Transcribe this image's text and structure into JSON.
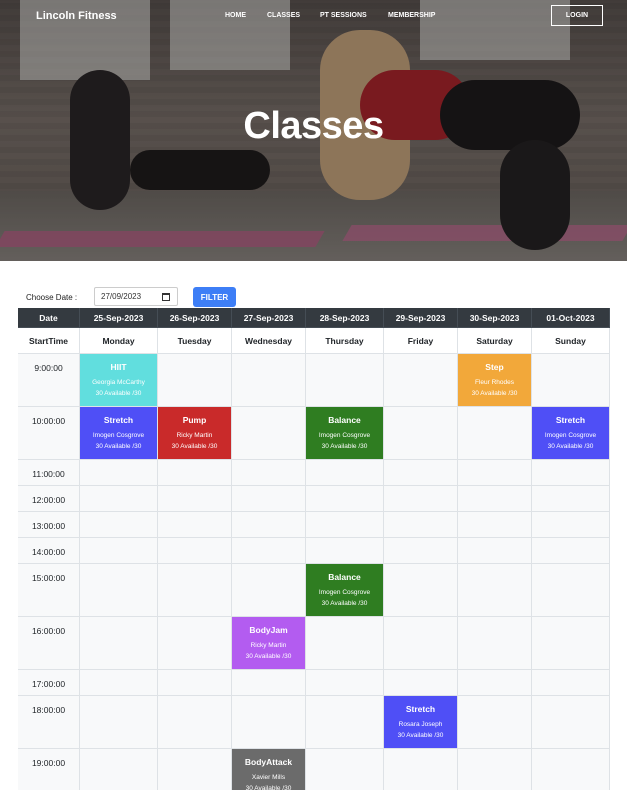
{
  "header": {
    "brand": "Lincoln Fitness",
    "nav": [
      "HOME",
      "CLASSES",
      "PT SESSIONS",
      "MEMBERSHIP"
    ],
    "login": "LOGIN",
    "title": "Classes"
  },
  "filter": {
    "label": "Choose Date :",
    "value": "27/09/2023",
    "button": "FILTER"
  },
  "timetable": {
    "col_date": "Date",
    "col_time": "StartTime",
    "dates": [
      "25-Sep-2023",
      "26-Sep-2023",
      "27-Sep-2023",
      "28-Sep-2023",
      "29-Sep-2023",
      "30-Sep-2023",
      "01-Oct-2023"
    ],
    "days": [
      "Monday",
      "Tuesday",
      "Wednesday",
      "Thursday",
      "Friday",
      "Saturday",
      "Sunday"
    ],
    "times": [
      "9:00:00",
      "10:00:00",
      "11:00:00",
      "12:00:00",
      "13:00:00",
      "14:00:00",
      "15:00:00",
      "16:00:00",
      "17:00:00",
      "18:00:00",
      "19:00:00"
    ],
    "classes": [
      {
        "name": "HIIT",
        "trainer": "Georgia McCarthy",
        "availability": "30 Available /30",
        "day": 0,
        "time": 0,
        "color": "#61dede"
      },
      {
        "name": "Step",
        "trainer": "Fleur Rhodes",
        "availability": "30 Available /30",
        "day": 5,
        "time": 0,
        "color": "#f2a83a"
      },
      {
        "name": "Stretch",
        "trainer": "Imogen Cosgrove",
        "availability": "30 Available /30",
        "day": 0,
        "time": 1,
        "color": "#4f4ff6"
      },
      {
        "name": "Pump",
        "trainer": "Ricky Martin",
        "availability": "30 Available /30",
        "day": 1,
        "time": 1,
        "color": "#c92a2a"
      },
      {
        "name": "Balance",
        "trainer": "Imogen Cosgrove",
        "availability": "30 Available /30",
        "day": 3,
        "time": 1,
        "color": "#2f7d21"
      },
      {
        "name": "Stretch",
        "trainer": "Imogen Cosgrove",
        "availability": "30 Available /30",
        "day": 6,
        "time": 1,
        "color": "#4f4ff6"
      },
      {
        "name": "Balance",
        "trainer": "Imogen Cosgrove",
        "availability": "30 Available /30",
        "day": 3,
        "time": 6,
        "color": "#2f7d21"
      },
      {
        "name": "BodyJam",
        "trainer": "Ricky Martin",
        "availability": "30 Available /30",
        "day": 2,
        "time": 7,
        "color": "#b35cf0"
      },
      {
        "name": "Stretch",
        "trainer": "Rosara Joseph",
        "availability": "30 Available /30",
        "day": 4,
        "time": 9,
        "color": "#4f4ff6"
      },
      {
        "name": "BodyAttack",
        "trainer": "Xavier Mills",
        "availability": "30 Available /30",
        "day": 2,
        "time": 10,
        "color": "#6b6b6b"
      }
    ]
  }
}
